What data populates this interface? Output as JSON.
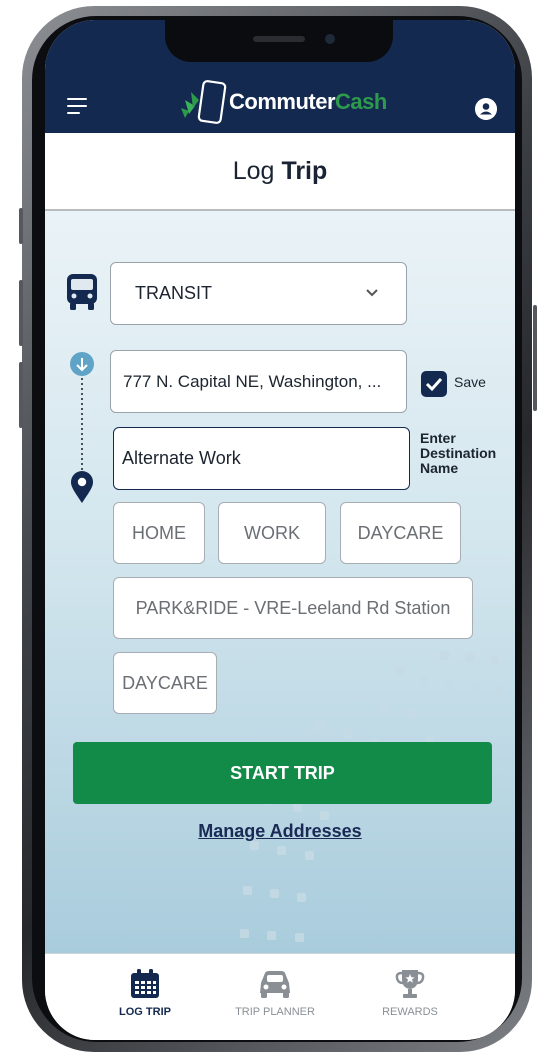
{
  "app": {
    "logo_part1": "Commuter",
    "logo_part2": "Cash",
    "page_title_light": "Log",
    "page_title_bold": "Trip"
  },
  "mode": {
    "selected": "TRANSIT"
  },
  "origin": {
    "value": "777 N. Capital NE, Washington, ...",
    "save_label": "Save",
    "save_checked": true
  },
  "destination": {
    "value": "Alternate Work",
    "hint": "Enter Destination Name"
  },
  "quick_destinations": [
    "HOME",
    "WORK",
    "DAYCARE",
    "PARK&RIDE - VRE-Leeland Rd Station",
    "DAYCARE"
  ],
  "actions": {
    "start_trip": "START TRIP",
    "manage_addresses": "Manage Addresses"
  },
  "bottom_nav": [
    {
      "label": "LOG TRIP",
      "icon": "calendar-icon",
      "active": true
    },
    {
      "label": "TRIP PLANNER",
      "icon": "car-icon",
      "active": false
    },
    {
      "label": "REWARDS",
      "icon": "trophy-icon",
      "active": false
    }
  ],
  "colors": {
    "header": "#13294f",
    "accent_green": "#128a48",
    "logo_green": "#2e9a4c",
    "route_dot": "#5fa3c6"
  }
}
